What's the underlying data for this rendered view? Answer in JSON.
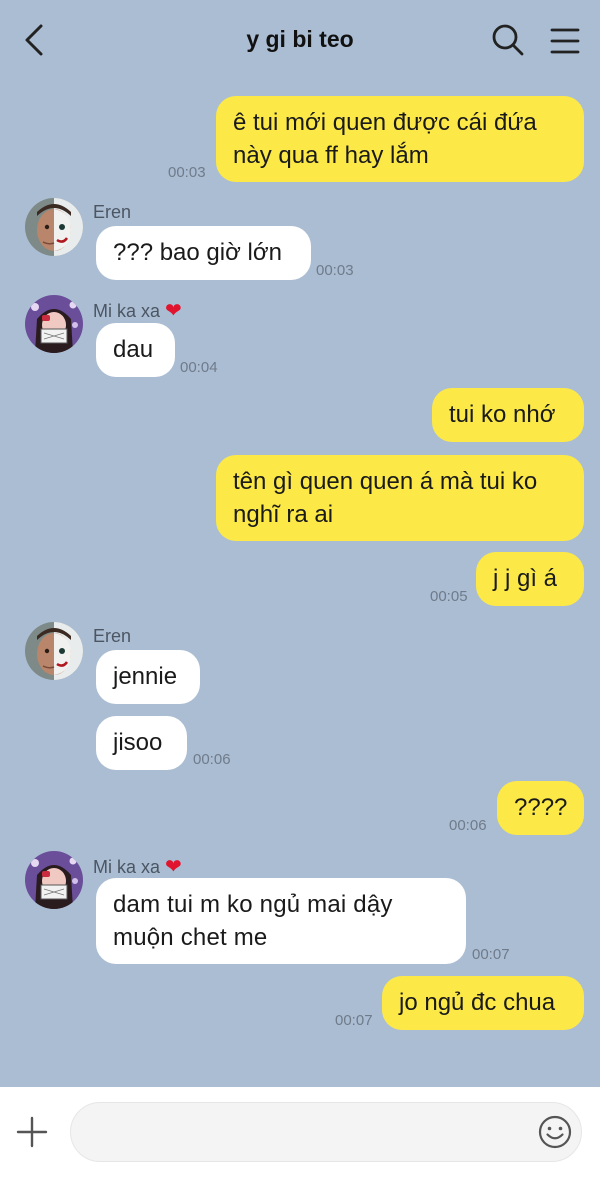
{
  "header": {
    "title": "y gi bi teo",
    "back_icon": "chevron-left-icon",
    "search_icon": "search-icon",
    "menu_icon": "hamburger-menu-icon"
  },
  "colors": {
    "background": "#abbdd3",
    "outgoing_bubble": "#fce948",
    "incoming_bubble": "#ffffff"
  },
  "messages": [
    {
      "direction": "out",
      "lines": [
        "ê tui mới quen được cái đứa",
        "này qua ff hay lắm"
      ],
      "time": "00:03"
    },
    {
      "direction": "in",
      "sender": "Eren",
      "lines": [
        "??? bao giờ lớn"
      ],
      "time": "00:03"
    },
    {
      "direction": "in",
      "sender": "Mi ka xa",
      "sender_emoji": "❤️",
      "lines": [
        "dau"
      ],
      "time": "00:04"
    },
    {
      "direction": "out",
      "lines": [
        "tui ko nhớ"
      ]
    },
    {
      "direction": "out",
      "lines": [
        "tên gì quen quen á mà tui ko",
        "nghĩ ra ai"
      ]
    },
    {
      "direction": "out",
      "lines": [
        "j j gì á"
      ],
      "time": "00:05"
    },
    {
      "direction": "in",
      "sender": "Eren",
      "lines": [
        "jennie"
      ]
    },
    {
      "direction": "in",
      "lines": [
        "jisoo"
      ],
      "time": "00:06"
    },
    {
      "direction": "out",
      "lines": [
        "????"
      ],
      "time": "00:06"
    },
    {
      "direction": "in",
      "sender": "Mi ka xa",
      "sender_emoji": "❤️",
      "lines": [
        "dam tui m ko ngủ mai dậy",
        "muộn chet me"
      ],
      "time": "00:07"
    },
    {
      "direction": "out",
      "lines": [
        "jo ngủ đc chua"
      ],
      "time": "00:07"
    }
  ],
  "composer": {
    "plus_icon": "plus-icon",
    "input_value": "",
    "emoji_icon": "smiley-face-icon"
  }
}
